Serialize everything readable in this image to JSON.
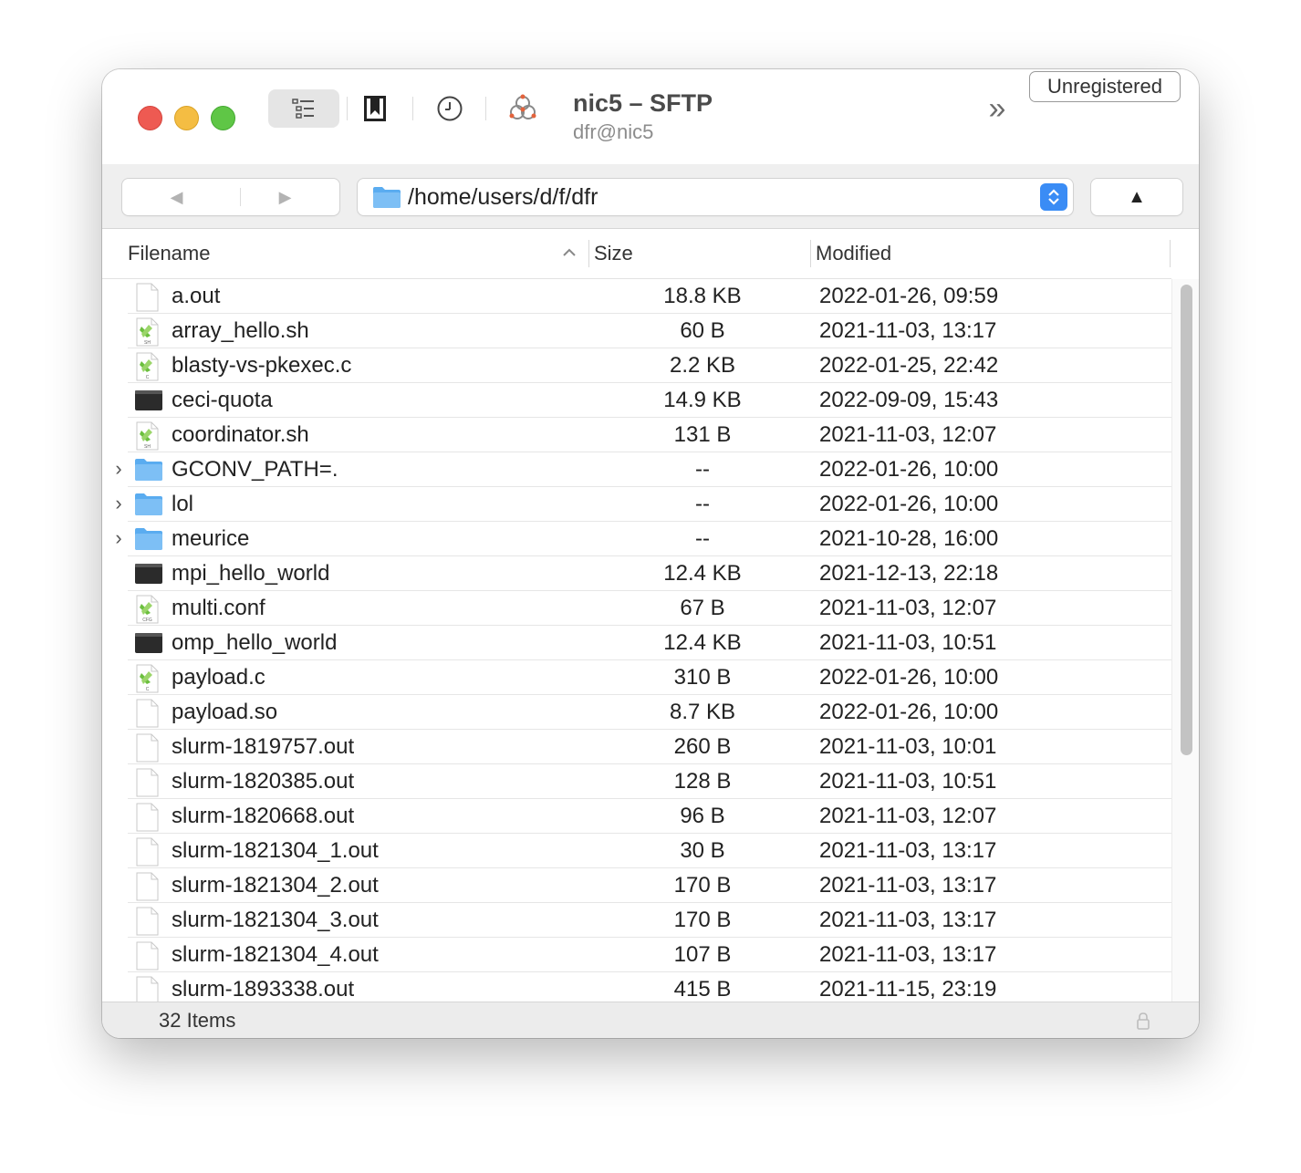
{
  "window": {
    "title": "nic5 – SFTP",
    "subtitle": "dfr@nic5"
  },
  "toolbar": {
    "outline_icon": "outline-view-icon",
    "bookmark_icon": "bookmark-icon",
    "history_icon": "history-icon",
    "connect_icon": "open-connection-icon",
    "more_label": "»",
    "unregistered_label": "Unregistered"
  },
  "navigation": {
    "back_label": "◀",
    "forward_label": "▶",
    "path": "/home/users/d/f/dfr",
    "up_label": "▲"
  },
  "columns": {
    "name": "Filename",
    "size": "Size",
    "modified": "Modified"
  },
  "files": [
    {
      "name": "a.out",
      "size": "18.8 KB",
      "modified": "2022-01-26, 09:59",
      "kind": "file"
    },
    {
      "name": "array_hello.sh",
      "size": "60 B",
      "modified": "2021-11-03, 13:17",
      "kind": "script",
      "tag": "SH"
    },
    {
      "name": "blasty-vs-pkexec.c",
      "size": "2.2 KB",
      "modified": "2022-01-25, 22:42",
      "kind": "script",
      "tag": "C"
    },
    {
      "name": "ceci-quota",
      "size": "14.9 KB",
      "modified": "2022-09-09, 15:43",
      "kind": "exec"
    },
    {
      "name": "coordinator.sh",
      "size": "131 B",
      "modified": "2021-11-03, 12:07",
      "kind": "script",
      "tag": "SH"
    },
    {
      "name": "GCONV_PATH=.",
      "size": "--",
      "modified": "2022-01-26, 10:00",
      "kind": "folder"
    },
    {
      "name": "lol",
      "size": "--",
      "modified": "2022-01-26, 10:00",
      "kind": "folder"
    },
    {
      "name": "meurice",
      "size": "--",
      "modified": "2021-10-28, 16:00",
      "kind": "folder"
    },
    {
      "name": "mpi_hello_world",
      "size": "12.4 KB",
      "modified": "2021-12-13, 22:18",
      "kind": "exec"
    },
    {
      "name": "multi.conf",
      "size": "67 B",
      "modified": "2021-11-03, 12:07",
      "kind": "script",
      "tag": "CFG"
    },
    {
      "name": "omp_hello_world",
      "size": "12.4 KB",
      "modified": "2021-11-03, 10:51",
      "kind": "exec"
    },
    {
      "name": "payload.c",
      "size": "310 B",
      "modified": "2022-01-26, 10:00",
      "kind": "script",
      "tag": "C"
    },
    {
      "name": "payload.so",
      "size": "8.7 KB",
      "modified": "2022-01-26, 10:00",
      "kind": "file"
    },
    {
      "name": "slurm-1819757.out",
      "size": "260 B",
      "modified": "2021-11-03, 10:01",
      "kind": "file"
    },
    {
      "name": "slurm-1820385.out",
      "size": "128 B",
      "modified": "2021-11-03, 10:51",
      "kind": "file"
    },
    {
      "name": "slurm-1820668.out",
      "size": "96 B",
      "modified": "2021-11-03, 12:07",
      "kind": "file"
    },
    {
      "name": "slurm-1821304_1.out",
      "size": "30 B",
      "modified": "2021-11-03, 13:17",
      "kind": "file"
    },
    {
      "name": "slurm-1821304_2.out",
      "size": "170 B",
      "modified": "2021-11-03, 13:17",
      "kind": "file"
    },
    {
      "name": "slurm-1821304_3.out",
      "size": "170 B",
      "modified": "2021-11-03, 13:17",
      "kind": "file"
    },
    {
      "name": "slurm-1821304_4.out",
      "size": "107 B",
      "modified": "2021-11-03, 13:17",
      "kind": "file"
    },
    {
      "name": "slurm-1893338.out",
      "size": "415 B",
      "modified": "2021-11-15, 23:19",
      "kind": "file"
    }
  ],
  "status": {
    "item_count": "32 Items",
    "lock_icon": "lock-icon"
  },
  "colors": {
    "accent": "#3a8cf5",
    "folder": "#5aacf0",
    "close": "#ee5a52",
    "minimize": "#f4bd43",
    "zoom": "#5fc646"
  }
}
